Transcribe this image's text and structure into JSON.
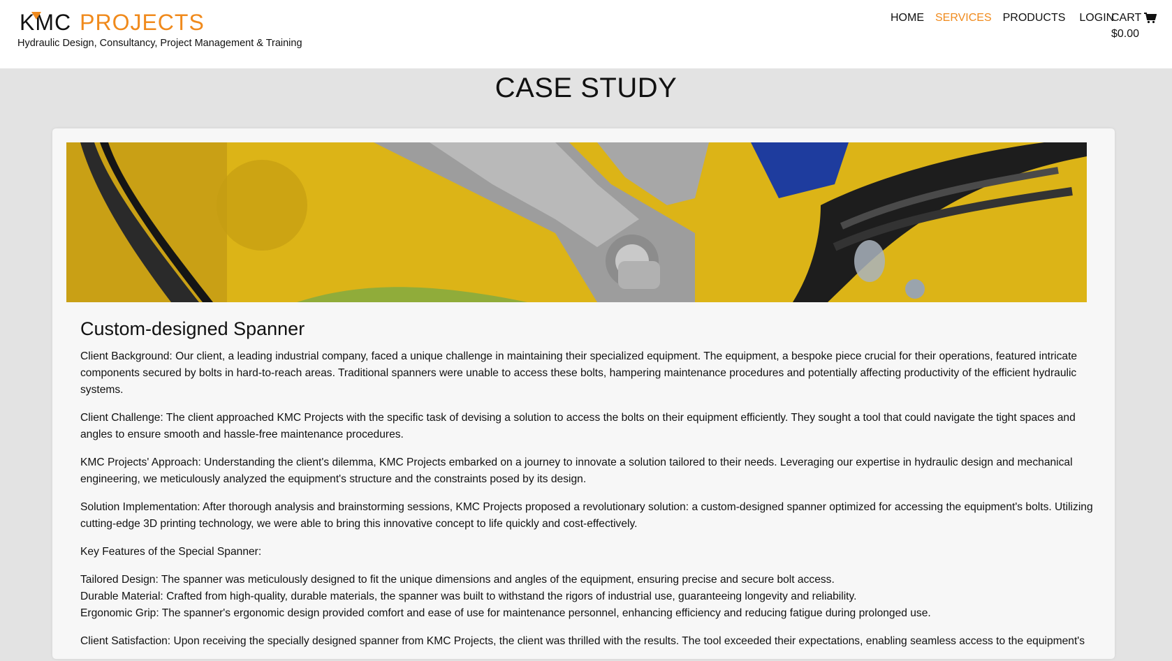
{
  "header": {
    "logo_kmc": "KMC",
    "logo_projects": "PROJECTS",
    "tagline": "Hydraulic Design, Consultancy, Project Management & Training"
  },
  "nav": {
    "home": "HOME",
    "services": "SERVICES",
    "products": "PRODUCTS",
    "login": "LOGIN",
    "cart": "CART",
    "cart_total": "$0.00"
  },
  "colors": {
    "accent": "#f08a1c",
    "page_bg": "#e3e3e3",
    "card_bg": "#f7f7f7"
  },
  "page_title": "CASE STUDY",
  "hero_image": "yellow-machinery-with-grey-spanner",
  "case": {
    "title": "Custom-designed Spanner",
    "background": "Client Background: Our client, a leading industrial company, faced a unique challenge in maintaining their specialized equipment. The equipment, a bespoke piece crucial for their operations, featured intricate components secured by bolts in hard-to-reach areas. Traditional spanners were unable to access these bolts, hampering maintenance procedures and potentially affecting productivity of the efficient hydraulic systems.",
    "challenge": "Client Challenge: The client approached KMC Projects with the specific task of devising a solution to access the bolts on their equipment efficiently. They sought a tool that could navigate the tight spaces and angles to ensure smooth and hassle-free maintenance procedures.",
    "approach": "KMC Projects' Approach: Understanding the client's dilemma, KMC Projects embarked on a journey to innovate a solution tailored to their needs. Leveraging our expertise in hydraulic design and mechanical engineering, we meticulously analyzed the equipment's structure and the constraints posed by its design.",
    "implementation": "Solution Implementation: After thorough analysis and brainstorming sessions, KMC Projects proposed a revolutionary solution: a custom-designed spanner optimized for accessing the equipment's bolts. Utilizing cutting-edge 3D printing technology, we were able to bring this innovative concept to life quickly and cost-effectively.",
    "features_heading": "Key Features of the Special Spanner:",
    "features": [
      "Tailored Design: The spanner was meticulously designed to fit the unique dimensions and angles of the equipment, ensuring precise and secure bolt access.",
      "Durable Material: Crafted from high-quality, durable materials, the spanner was built to withstand the rigors of industrial use, guaranteeing longevity and reliability.",
      "Ergonomic Grip: The spanner's ergonomic design provided comfort and ease of use for maintenance personnel, enhancing efficiency and reducing fatigue during prolonged use."
    ],
    "satisfaction": "Client Satisfaction: Upon receiving the specially designed spanner from KMC Projects, the client was thrilled with the results. The tool exceeded their expectations, enabling seamless access to the equipment's"
  }
}
